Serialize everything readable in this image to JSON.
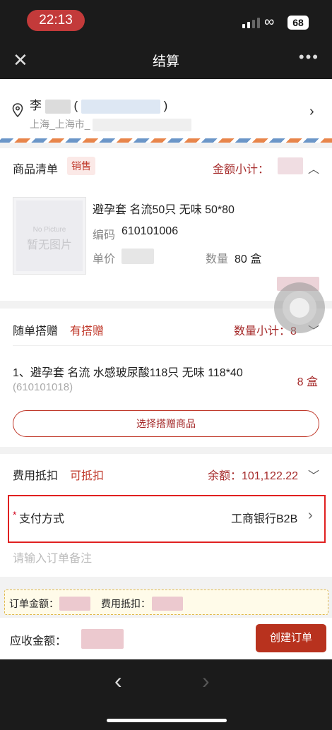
{
  "status_bar": {
    "time": "22:13",
    "battery": "68"
  },
  "nav": {
    "title": "结算",
    "close_icon": "close-icon",
    "more_label": "•••"
  },
  "address": {
    "name_prefix": "李",
    "open_paren": "(",
    "close_paren": ")",
    "city": "上海_上海市_"
  },
  "goods": {
    "title": "商品清单",
    "tag": "销售",
    "subtotal_label": "金额小计：",
    "product": {
      "name": "避孕套 名流50只 无味 50*80",
      "code_label": "编码",
      "code": "610101006",
      "price_label": "单价",
      "qty_label": "数量",
      "qty": "80 盒",
      "thumb_en": "No Picture",
      "thumb_cn": "暂无图片"
    }
  },
  "gift": {
    "title": "随单搭赠",
    "tag": "有搭赠",
    "qty_subtotal": "数量小计：8",
    "item_name": "1、避孕套 名流 水感玻尿酸118只 无味 118*40",
    "item_code": "(610101018)",
    "item_qty": "8 盒",
    "select_button": "选择搭赠商品"
  },
  "fee": {
    "title": "费用抵扣",
    "tag": "可抵扣",
    "balance": "余额：101,122.22"
  },
  "payment": {
    "required_mark": "*",
    "label": "支付方式",
    "value": "工商银行B2B"
  },
  "remark": {
    "placeholder": "请输入订单备注"
  },
  "summary": {
    "order_amount_label": "订单金额：",
    "fee_deduct_label": "费用抵扣："
  },
  "footer": {
    "receivable_label": "应收金额：",
    "create_button": "创建订单"
  },
  "colors": {
    "accent": "#b8321e",
    "highlight_box": "#e02020"
  }
}
